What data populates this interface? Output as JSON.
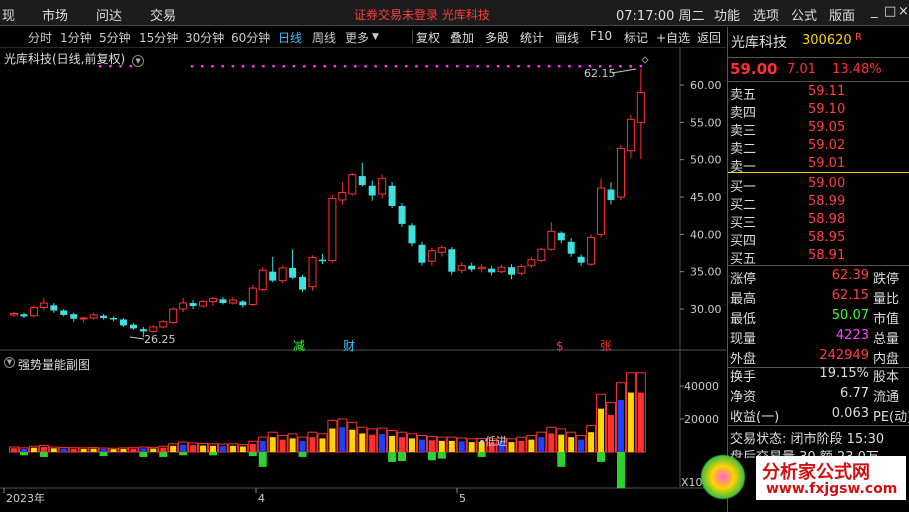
{
  "menu": {
    "items": [
      "现",
      "市场",
      "问达",
      "交易"
    ],
    "status": "证券交易未登录  光库科技",
    "time": "07:17:00",
    "weekday": "周二",
    "right": [
      "功能",
      "选项",
      "公式",
      "版面"
    ],
    "win": [
      "_",
      "□",
      "×"
    ]
  },
  "periods": [
    "分时",
    "1分钟",
    "5分钟",
    "15分钟",
    "30分钟",
    "60分钟",
    "日线",
    "周线",
    "更多"
  ],
  "active_period": "日线",
  "tools": [
    "复权",
    "叠加",
    "多股",
    "统计",
    "画线",
    "F10",
    "标记",
    "+自选",
    "返回"
  ],
  "chart": {
    "title": "光库科技(日线,前复权)",
    "high_label": "62.15",
    "low_label": "26.25",
    "markers": [
      "减",
      "财",
      "$",
      "张"
    ],
    "y_ticks": [
      "60.00",
      "55.00",
      "50.00",
      "45.00",
      "40.00",
      "35.00",
      "30.00"
    ],
    "x_ticks": [
      "2023年",
      "4",
      "5"
    ],
    "sub_title": "强势量能副图",
    "sub_y_ticks": [
      "40000",
      "20000"
    ],
    "sub_label": "低进",
    "x10": "X10"
  },
  "quote": {
    "name": "光库科技",
    "code": "300620",
    "r_mark": "R",
    "price": "59.00",
    "change": "7.01",
    "pct": "13.48%",
    "asks": [
      [
        "卖五",
        "59.11"
      ],
      [
        "卖四",
        "59.10"
      ],
      [
        "卖三",
        "59.05"
      ],
      [
        "卖二",
        "59.02"
      ],
      [
        "卖一",
        "59.01"
      ]
    ],
    "bids": [
      [
        "买一",
        "59.00"
      ],
      [
        "买二",
        "58.99"
      ],
      [
        "买三",
        "58.98"
      ],
      [
        "买四",
        "58.95"
      ],
      [
        "买五",
        "58.91"
      ]
    ],
    "stats": [
      {
        "l": "涨停",
        "v": "62.39",
        "r": "跌停",
        "c": "#ff4040"
      },
      {
        "l": "最高",
        "v": "62.15",
        "r": "量比",
        "c": "#ff4040"
      },
      {
        "l": "最低",
        "v": "50.07",
        "r": "市值",
        "c": "#30ff30"
      },
      {
        "l": "现量",
        "v": "4223",
        "r": "总量",
        "c": "#ff40ff"
      },
      {
        "l": "外盘",
        "v": "242949",
        "r": "内盘",
        "c": "#ff4040"
      }
    ],
    "stats2": [
      {
        "l": "换手",
        "v": "19.15%",
        "r": "股本"
      },
      {
        "l": "净资",
        "v": "6.77",
        "r": "流通"
      },
      {
        "l": "收益(一)",
        "v": "0.063",
        "r": "PE(动)"
      }
    ],
    "trade_state": "交易状态: 闭市阶段 15:30",
    "after_hours": "盘后交易量 30 额 23.0万"
  },
  "watermark": {
    "text1": "分析家公式网",
    "text2": "www.fxjgsw.com"
  },
  "colors": {
    "up": "#ff3030",
    "down": "#40e0e0",
    "vol_yellow": "#ffd700",
    "vol_blue": "#2040ff",
    "vol_green": "#30d030",
    "magenta": "#ff30ff"
  }
}
